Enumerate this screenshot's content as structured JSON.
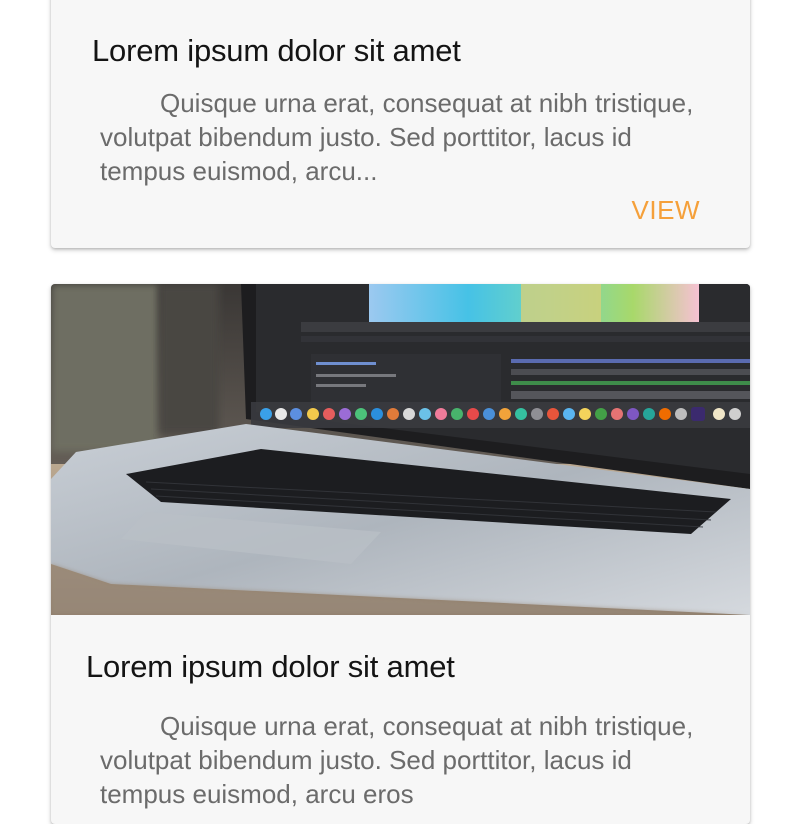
{
  "cards": [
    {
      "title": "Lorem ipsum dolor sit amet",
      "text": "Quisque urna erat, consequat at nibh tristique, volutpat bibendum justo. Sed porttitor, lacus id tempus euismod, arcu...",
      "action_label": "VIEW"
    },
    {
      "image_alt": "laptop-photo",
      "title": "Lorem ipsum dolor sit amet",
      "text": "Quisque urna erat, consequat at nibh tristique, volutpat bibendum justo. Sed porttitor, lacus id tempus euismod, arcu eros"
    }
  ],
  "colors": {
    "card_background": "#f7f7f7",
    "title": "#141414",
    "body_text": "#6b6b6b",
    "accent": "#f5a03a"
  }
}
